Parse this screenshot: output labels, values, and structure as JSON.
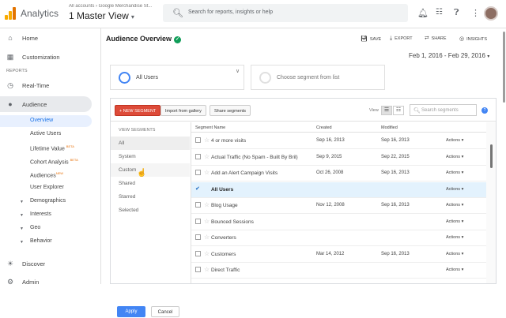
{
  "header": {
    "app_name": "Analytics",
    "account_path": "All accounts › Google Merchandise St...",
    "view_name": "1 Master View",
    "view_caret": "▾",
    "search_placeholder": "Search for reports, insights or help",
    "icons": [
      "bell-icon",
      "apps-icon",
      "help-icon",
      "more-icon"
    ]
  },
  "sidebar": {
    "items": [
      {
        "icon": "home-icon",
        "glyph": "⌂",
        "label": "Home"
      },
      {
        "icon": "customization-icon",
        "glyph": "▦",
        "label": "Customization"
      },
      {
        "icon": "clock-icon",
        "glyph": "◷",
        "label": "Real-Time"
      },
      {
        "icon": "person-icon",
        "glyph": "●",
        "label": "Audience"
      }
    ],
    "section_reports": "REPORTS",
    "sub_items": [
      {
        "label": "Overview",
        "active": true
      },
      {
        "label": "Active Users"
      },
      {
        "label": "Lifetime Value",
        "badge": "BETA"
      },
      {
        "label": "Cohort Analysis",
        "badge": "BETA"
      },
      {
        "label": "Audiences",
        "badge": "NEW"
      },
      {
        "label": "User Explorer"
      }
    ],
    "expandables": [
      "Demographics",
      "Interests",
      "Geo",
      "Behavior"
    ],
    "bottom": [
      {
        "icon": "lightbulb-icon",
        "glyph": "☀",
        "label": "Discover"
      },
      {
        "icon": "admin-gear-icon",
        "glyph": "⚙",
        "label": "Admin"
      }
    ]
  },
  "main": {
    "title": "Audience Overview",
    "verified": "✓",
    "toolbar": {
      "save": "SAVE",
      "export": "EXPORT",
      "share": "SHARE",
      "insights": "INSIGHTS"
    },
    "date_range": "Feb 1, 2016 - Feb 29, 2016",
    "segments": {
      "active": "All Users",
      "choose": "Choose segment from list"
    }
  },
  "segment_panel": {
    "new_segment": "+ NEW SEGMENT",
    "import": "Import from gallery",
    "share": "Share segments",
    "view_label": "View",
    "search_placeholder": "Search segments",
    "help": "?",
    "categories_header": "VIEW SEGMENTS",
    "categories": [
      "All",
      "System",
      "Custom",
      "Shared",
      "Starred",
      "Selected"
    ],
    "selected_category": "All",
    "columns": {
      "name": "Segment Name",
      "created": "Created",
      "modified": "Modified"
    },
    "rows": [
      {
        "name": "4 or more visits",
        "created": "Sep 16, 2013",
        "modified": "Sep 16, 2013",
        "actions": "Actions ▾"
      },
      {
        "name": "Actual Traffic (No Spam - Built By Bril)",
        "created": "Sep 9, 2015",
        "modified": "Sep 22, 2015",
        "actions": "Actions ▾"
      },
      {
        "name": "Add an Alert Campaign Visits",
        "created": "Oct 26, 2008",
        "modified": "Sep 16, 2013",
        "actions": "Actions ▾"
      },
      {
        "name": "All Users",
        "created": "",
        "modified": "",
        "actions": "Actions ▾",
        "checked": true
      },
      {
        "name": "Blog Usage",
        "created": "Nov 12, 2008",
        "modified": "Sep 16, 2013",
        "actions": "Actions ▾"
      },
      {
        "name": "Bounced Sessions",
        "created": "",
        "modified": "",
        "actions": "Actions ▾"
      },
      {
        "name": "Converters",
        "created": "",
        "modified": "",
        "actions": "Actions ▾"
      },
      {
        "name": "Customers",
        "created": "Mar 14, 2012",
        "modified": "Sep 16, 2013",
        "actions": "Actions ▾"
      },
      {
        "name": "Direct Traffic",
        "created": "",
        "modified": "",
        "actions": "Actions ▾"
      }
    ],
    "apply": "Apply",
    "cancel": "Cancel"
  },
  "colors": {
    "accent_blue": "#4285f4",
    "new_segment_red": "#dd4b39",
    "active_nav_bg": "#e8eaed"
  }
}
